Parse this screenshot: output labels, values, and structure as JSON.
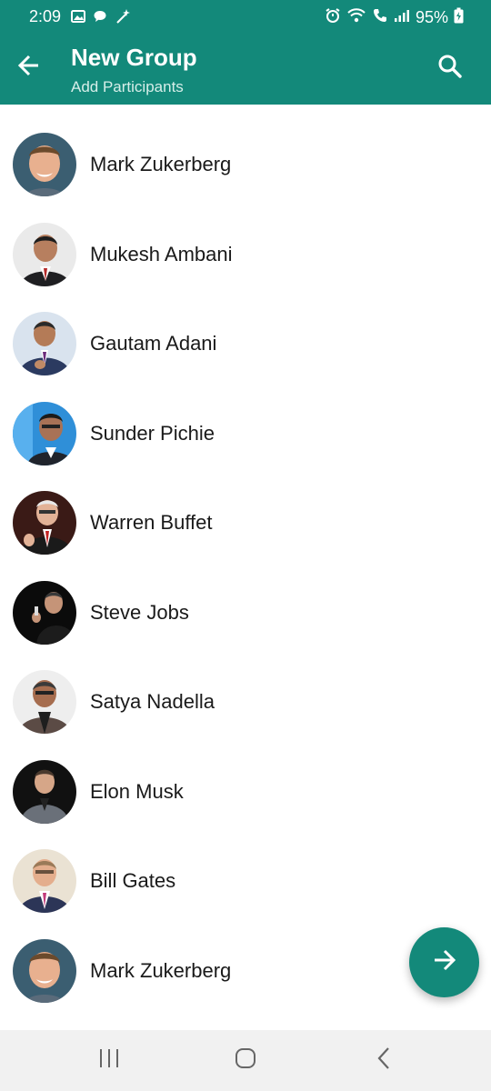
{
  "status_bar": {
    "time": "2:09",
    "battery": "95%"
  },
  "app_bar": {
    "title": "New Group",
    "subtitle": "Add Participants",
    "back_icon": "arrow-back-icon",
    "search_icon": "search-icon",
    "color": "#13897a"
  },
  "contacts": [
    {
      "name": "Mark Zukerberg"
    },
    {
      "name": "Mukesh Ambani"
    },
    {
      "name": "Gautam Adani"
    },
    {
      "name": "Sunder Pichie"
    },
    {
      "name": "Warren Buffet"
    },
    {
      "name": "Steve Jobs"
    },
    {
      "name": "Satya Nadella"
    },
    {
      "name": "Elon Musk"
    },
    {
      "name": "Bill Gates"
    },
    {
      "name": "Mark Zukerberg"
    }
  ],
  "fab": {
    "icon": "arrow-forward-icon"
  },
  "nav_bar": {
    "recents_icon": "recents-icon",
    "home_icon": "home-icon",
    "back_icon": "back-icon"
  }
}
